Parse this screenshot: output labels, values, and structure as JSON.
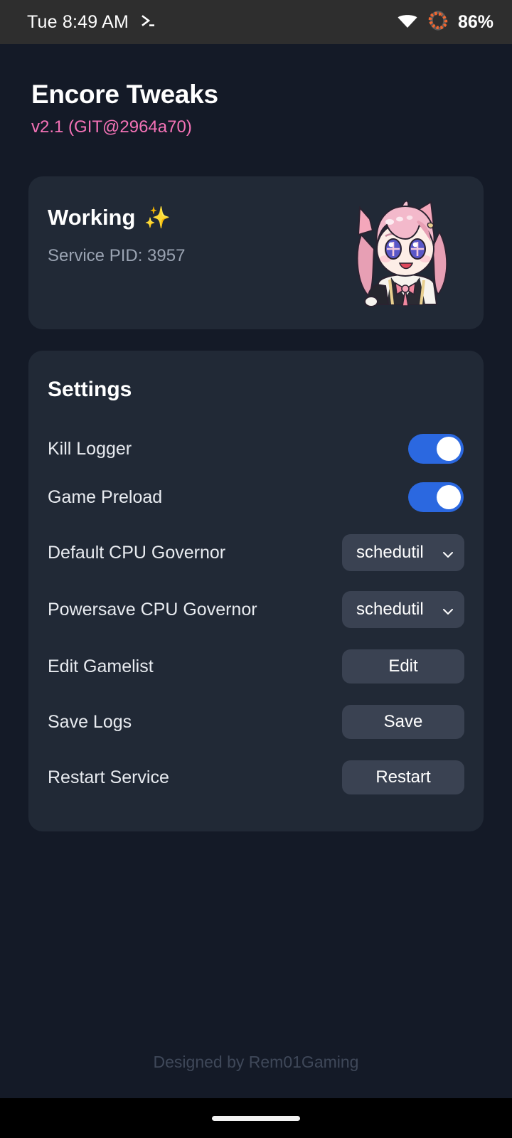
{
  "statusbar": {
    "clock": "Tue 8:49 AM",
    "terminal_icon": "terminal-prompt-icon",
    "wifi_icon": "wifi-icon",
    "battery_icon": "battery-ring-icon",
    "battery_text": "86%",
    "battery_ring_color": "#f2662f",
    "background": "#2e2e2e"
  },
  "header": {
    "title": "Encore Tweaks",
    "version": "v2.1 (GIT@2964a70)",
    "version_color": "#f472b6"
  },
  "status_card": {
    "title": "Working",
    "title_emoji": "✨",
    "subtitle": "Service PID: 3957",
    "mascot_icon": "anime-mascot-icon"
  },
  "settings_card": {
    "title": "Settings",
    "rows": [
      {
        "label": "Kill Logger",
        "control": "toggle",
        "value": "on",
        "name": "kill-logger"
      },
      {
        "label": "Game Preload",
        "control": "toggle",
        "value": "on",
        "name": "game-preload"
      },
      {
        "label": "Default CPU Governor",
        "control": "dropdown",
        "value": "schedutil",
        "name": "default-cpu-governor"
      },
      {
        "label": "Powersave CPU Governor",
        "control": "dropdown",
        "value": "schedutil",
        "name": "powersave-cpu-governor"
      },
      {
        "label": "Edit Gamelist",
        "control": "button",
        "value": "Edit",
        "name": "edit-gamelist"
      },
      {
        "label": "Save Logs",
        "control": "button",
        "value": "Save",
        "name": "save-logs"
      },
      {
        "label": "Restart Service",
        "control": "button",
        "value": "Restart",
        "name": "restart-service"
      }
    ]
  },
  "footer": {
    "credit": "Designed by Rem01Gaming"
  },
  "navbar": {
    "gesture_pill": "home-gesture-pill"
  },
  "theme": {
    "page_bg": "#141a27",
    "card_bg": "#212936",
    "control_bg": "#3a4252",
    "toggle_on": "#2b68e0",
    "accent_pink": "#f472b6"
  }
}
